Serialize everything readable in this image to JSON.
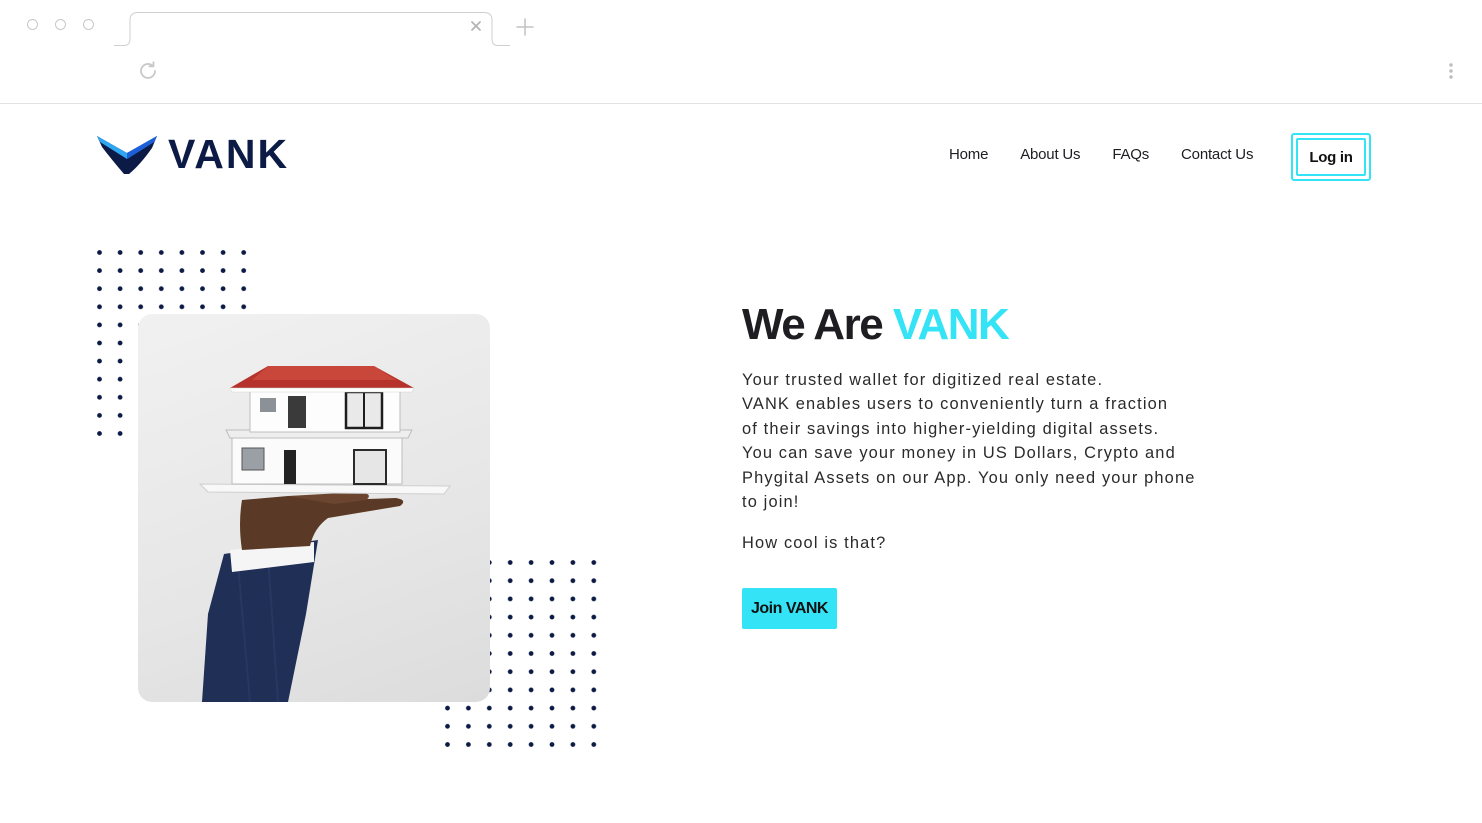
{
  "browser": {
    "new_tab_symbol": "+",
    "icons": [
      "close-icon",
      "plus-icon",
      "reload-icon",
      "more-vertical-icon"
    ]
  },
  "site": {
    "brand": "VANK",
    "colors": {
      "accent": "#35e3f6",
      "navy": "#0c1b45",
      "text": "#1d1d22"
    },
    "nav": [
      {
        "label": "Home"
      },
      {
        "label": "About Us"
      },
      {
        "label": "FAQs"
      },
      {
        "label": "Contact Us"
      }
    ],
    "login_label": "Log in"
  },
  "hero": {
    "title_prefix": "We Are ",
    "title_accent": "VANK",
    "paragraph_lines": [
      "Your trusted wallet for digitized real estate.",
      "VANK enables users to conveniently turn a fraction",
      "of their savings into higher-yielding digital assets.",
      "You can save your money in US Dollars, Crypto and",
      "Phygital Assets on our App. You only need your phone",
      "to join!"
    ],
    "cool_line": "How cool is that?",
    "cta_label": "Join VANK"
  }
}
